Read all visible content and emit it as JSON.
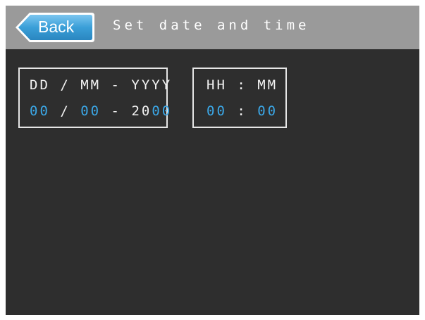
{
  "header": {
    "back_label": "Back",
    "title": "Set date and time"
  },
  "date": {
    "format_label": "DD / MM - YYYY",
    "day": "00",
    "sep1": " / ",
    "month": "00",
    "sep2": " - ",
    "year_prefix": "20",
    "year_suffix": "00"
  },
  "time": {
    "format_label": "HH : MM",
    "hour": "00",
    "sep": " : ",
    "minute": "00"
  },
  "colors": {
    "background": "#2e2e2e",
    "header": "#9a9a9a",
    "back_button": "#3a9fd8",
    "editable_value": "#3ba8e8",
    "text": "#ffffff"
  }
}
